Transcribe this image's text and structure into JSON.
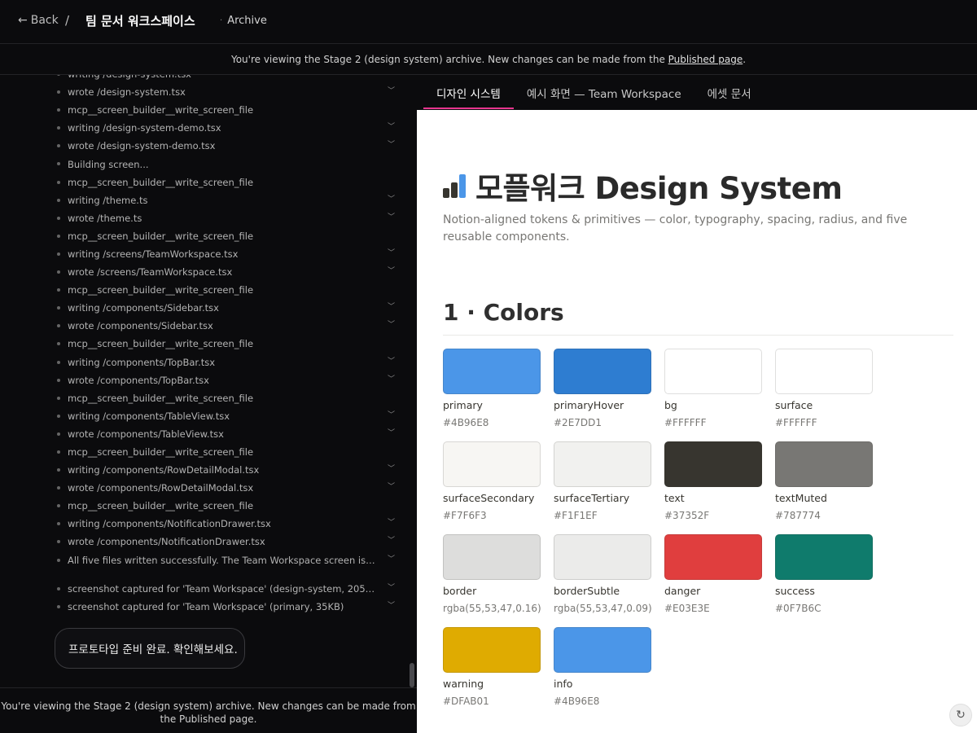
{
  "topbar": {
    "back_label": "Back",
    "separator": "/",
    "workspace_title": "팀 문서 워크스페이스",
    "archive_label": "Archive"
  },
  "banner": {
    "text_before": "You're viewing the Stage 2 (design system) archive. New changes can be made from the ",
    "link_text": "Published page",
    "text_after": "."
  },
  "log": {
    "items_a": [
      "writing /design-system.tsx",
      "wrote /design-system.tsx",
      "mcp__screen_builder__write_screen_file",
      "writing /design-system-demo.tsx",
      "wrote /design-system-demo.tsx",
      "Building screen...",
      "mcp__screen_builder__write_screen_file",
      "writing /theme.ts",
      "wrote /theme.ts",
      "mcp__screen_builder__write_screen_file",
      "writing /screens/TeamWorkspace.tsx",
      "wrote /screens/TeamWorkspace.tsx",
      "mcp__screen_builder__write_screen_file",
      "writing /components/Sidebar.tsx",
      "wrote /components/Sidebar.tsx",
      "mcp__screen_builder__write_screen_file",
      "writing /components/TopBar.tsx",
      "wrote /components/TopBar.tsx",
      "mcp__screen_builder__write_screen_file",
      "writing /components/TableView.tsx",
      "wrote /components/TableView.tsx",
      "mcp__screen_builder__write_screen_file",
      "writing /components/RowDetailModal.tsx",
      "wrote /components/RowDetailModal.tsx",
      "mcp__screen_builder__write_screen_file",
      "writing /components/NotificationDrawer.tsx",
      "wrote /components/NotificationDrawer.tsx",
      "All five files written successfully. The Team Workspace screen is fully as..."
    ],
    "items_b": [
      "screenshot captured for 'Team Workspace' (design-system, 205KB)",
      "screenshot captured for 'Team Workspace' (primary, 35KB)"
    ],
    "bubble": "프로토타입 준비 완료. 확인해보세요."
  },
  "left_footer": "You're viewing the Stage 2 (design system) archive. New changes can be made from the Published page.",
  "tabs": [
    {
      "label": "디자인 시스템",
      "active": true
    },
    {
      "label": "예시 화면 — Team Workspace",
      "active": false
    },
    {
      "label": "에셋 문서",
      "active": false
    }
  ],
  "design": {
    "title": "모플워크 Design System",
    "description": "Notion-aligned tokens & primitives — color, typography, spacing, radius, and five reusable components.",
    "section_title": "1 · Colors",
    "icon_colors": [
      "#37352f",
      "#37352f",
      "#4B96E8"
    ],
    "swatches": [
      {
        "name": "primary",
        "value": "#4B96E8",
        "color": "#4B96E8"
      },
      {
        "name": "primaryHover",
        "value": "#2E7DD1",
        "color": "#2E7DD1"
      },
      {
        "name": "bg",
        "value": "#FFFFFF",
        "color": "#FFFFFF"
      },
      {
        "name": "surface",
        "value": "#FFFFFF",
        "color": "#FFFFFF"
      },
      {
        "name": "surfaceSecondary",
        "value": "#F7F6F3",
        "color": "#F7F6F3"
      },
      {
        "name": "surfaceTertiary",
        "value": "#F1F1EF",
        "color": "#F1F1EF"
      },
      {
        "name": "text",
        "value": "#37352F",
        "color": "#37352F"
      },
      {
        "name": "textMuted",
        "value": "#787774",
        "color": "#787774"
      },
      {
        "name": "border",
        "value": "rgba(55,53,47,0.16)",
        "color": "#DDDDDC"
      },
      {
        "name": "borderSubtle",
        "value": "rgba(55,53,47,0.09)",
        "color": "#EBEBEA"
      },
      {
        "name": "danger",
        "value": "#E03E3E",
        "color": "#E03E3E"
      },
      {
        "name": "success",
        "value": "#0F7B6C",
        "color": "#0F7B6C"
      },
      {
        "name": "warning",
        "value": "#DFAB01",
        "color": "#DFAB01"
      },
      {
        "name": "info",
        "value": "#4B96E8",
        "color": "#4B96E8"
      }
    ]
  },
  "accent_colors": {
    "tab_underline": "#E8368F"
  }
}
